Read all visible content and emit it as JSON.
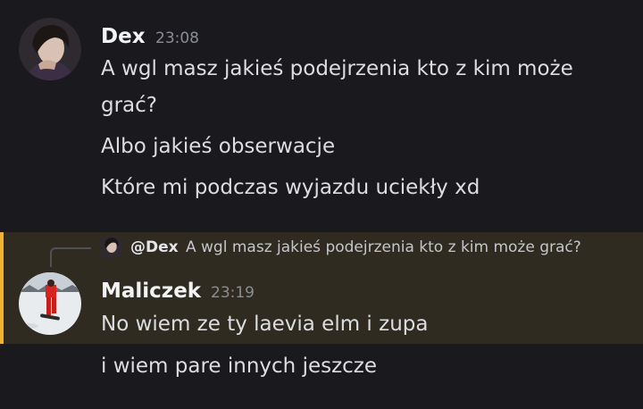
{
  "messages": [
    {
      "author": "Dex",
      "time": "23:08",
      "lines": [
        "A wgl masz jakieś podejrzenia kto z kim może",
        "grać?",
        "Albo jakieś obserwacje",
        "Które mi podczas wyjazdu uciekły xd"
      ]
    },
    {
      "author": "Maliczek",
      "time": "23:19",
      "reply": {
        "mention": "@Dex",
        "text": "A wgl masz jakieś podejrzenia kto z kim może grać?"
      },
      "lines": [
        "No wiem ze ty laevia elm i zupa",
        "i wiem pare innych jeszcze"
      ]
    }
  ],
  "colors": {
    "background": "#1a1a1e",
    "highlight": "#2f2b20",
    "highlight_bar": "#f0b232"
  }
}
